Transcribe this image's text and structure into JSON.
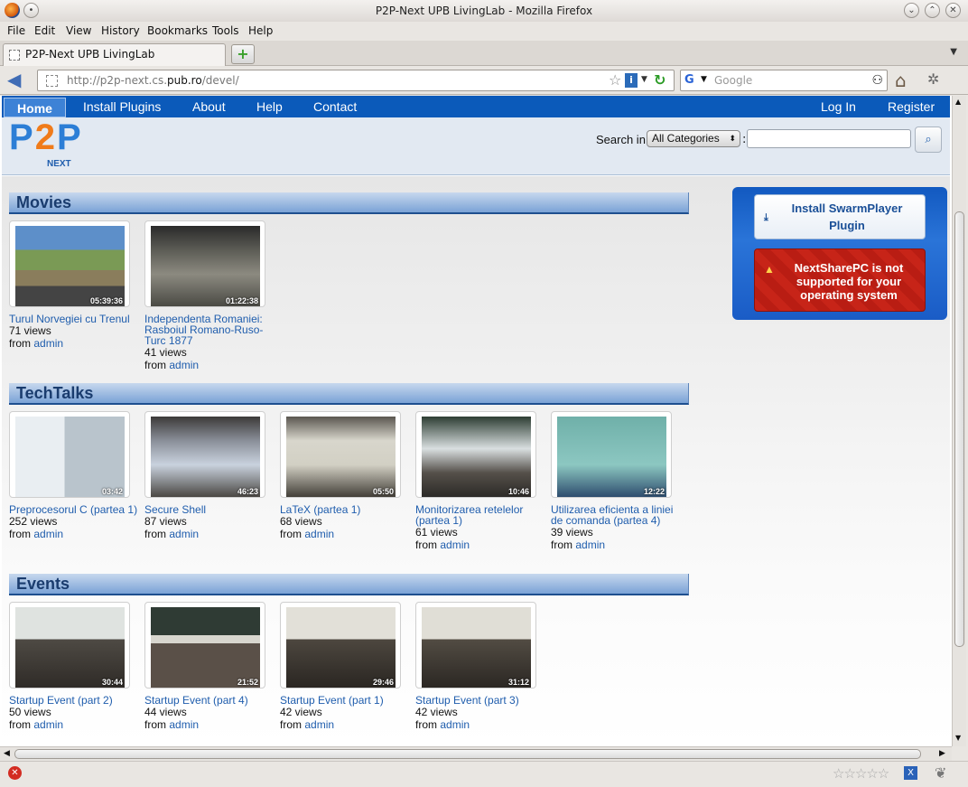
{
  "window": {
    "title": "P2P-Next UPB LivingLab - Mozilla Firefox"
  },
  "menu": [
    "File",
    "Edit",
    "View",
    "History",
    "Bookmarks",
    "Tools",
    "Help"
  ],
  "tab": {
    "label": "P2P-Next UPB LivingLab"
  },
  "address": {
    "prefix": "http://p2p-next.cs.",
    "host": "pub.ro",
    "path": "/devel/"
  },
  "search": {
    "placeholder": "Google"
  },
  "site_nav": {
    "home": "Home",
    "install": "Install Plugins",
    "about": "About",
    "help": "Help",
    "contact": "Contact",
    "login": "Log In",
    "register": "Register"
  },
  "logo": {
    "p": "P",
    "two": "2",
    "p2": "P",
    "next": "NEXT"
  },
  "site_search": {
    "label": "Search in",
    "category": "All Categories",
    "colon": ":"
  },
  "sections": {
    "movies": {
      "title": "Movies",
      "items": [
        {
          "title": "Turul Norvegiei cu Trenul",
          "views": "71 views",
          "from": "from",
          "user": "admin",
          "duration": "05:39:36"
        },
        {
          "title": "Independenta Romaniei: Rasboiul Romano-Ruso-Turc 1877",
          "views": "41 views",
          "from": "from",
          "user": "admin",
          "duration": "01:22:38"
        }
      ]
    },
    "techtalks": {
      "title": "TechTalks",
      "items": [
        {
          "title": "Preprocesorul C (partea 1)",
          "views": "252 views",
          "from": "from",
          "user": "admin",
          "duration": "03:42"
        },
        {
          "title": "Secure Shell",
          "views": "87 views",
          "from": "from",
          "user": "admin",
          "duration": "46:23"
        },
        {
          "title": "LaTeX (partea 1)",
          "views": "68 views",
          "from": "from",
          "user": "admin",
          "duration": "05:50"
        },
        {
          "title": "Monitorizarea retelelor (partea 1)",
          "views": "61 views",
          "from": "from",
          "user": "admin",
          "duration": "10:46"
        },
        {
          "title": "Utilizarea eficienta a liniei de comanda (partea 4)",
          "views": "39 views",
          "from": "from",
          "user": "admin",
          "duration": "12:22"
        }
      ]
    },
    "events": {
      "title": "Events",
      "items": [
        {
          "title": "Startup Event (part 2)",
          "views": "50 views",
          "from": "from",
          "user": "admin",
          "duration": "30:44"
        },
        {
          "title": "Startup Event (part 4)",
          "views": "44 views",
          "from": "from",
          "user": "admin",
          "duration": "21:52"
        },
        {
          "title": "Startup Event (part 1)",
          "views": "42 views",
          "from": "from",
          "user": "admin",
          "duration": "29:46"
        },
        {
          "title": "Startup Event (part 3)",
          "views": "42 views",
          "from": "from",
          "user": "admin",
          "duration": "31:12"
        }
      ]
    }
  },
  "sidebar": {
    "install": "Install SwarmPlayer Plugin",
    "warning": "NextSharePC is not supported for your operating system"
  },
  "colors": {
    "nav": "#0b5aba",
    "link": "#1f5dad",
    "section_heading": "#1a3c6e",
    "warning": "#c72418"
  }
}
